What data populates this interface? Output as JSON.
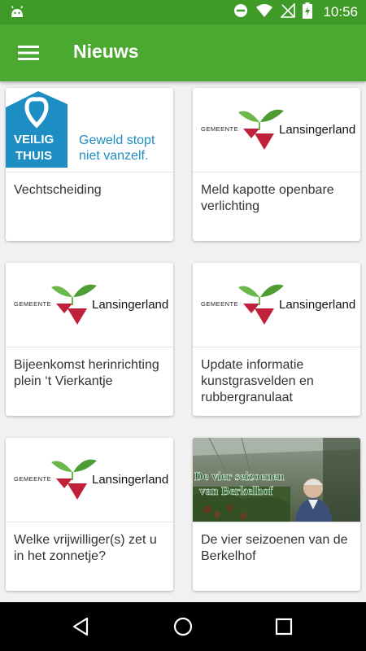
{
  "status_bar": {
    "time": "10:56",
    "icons": [
      "android-icon",
      "do-not-disturb-icon",
      "wifi-icon",
      "no-signal-icon",
      "battery-charging-icon"
    ]
  },
  "app_bar": {
    "title": "Nieuws",
    "menu_icon": "hamburger-menu-icon",
    "color": "#4ba932",
    "status_color": "#3f9a28"
  },
  "logos": {
    "veilig_thuis": {
      "line1": "VEILIG",
      "line2": "THUIS",
      "slogan1": "Geweld stopt",
      "slogan2": "niet vanzelf."
    },
    "lansingerland": {
      "prefix": "GEMEENTE",
      "name": "Lansingerland"
    },
    "berkelhof": {
      "overlay1": "De vier seizoenen",
      "overlay2": "van Berkelhof"
    }
  },
  "news": [
    {
      "title": "Vechtscheiding",
      "image": "veilig-thuis-logo"
    },
    {
      "title": "Meld kapotte openbare verlichting",
      "image": "lansingerland-logo"
    },
    {
      "title": "Bijeenkomst herinrichting plein ‘t Vierkantje",
      "image": "lansingerland-logo"
    },
    {
      "title": "Update  informatie kunstgrasvelden en rubbergranulaat",
      "image": "lansingerland-logo"
    },
    {
      "title": "Welke vrijwilliger(s) zet u in het zonnetje?",
      "image": "lansingerland-logo"
    },
    {
      "title": "De vier seizoenen van de Berkelhof",
      "image": "berkelhof-photo"
    }
  ],
  "nav_bar": {
    "buttons": [
      "back-icon",
      "home-icon",
      "recents-icon"
    ]
  }
}
